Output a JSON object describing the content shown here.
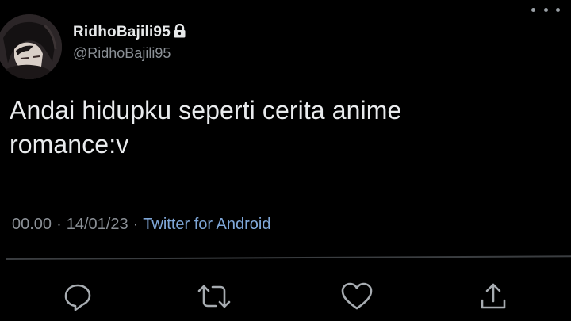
{
  "tweet": {
    "display_name": "RidhoBajili95",
    "handle": "@RidhoBajili95",
    "text": "Andai hidupku seperti cerita anime romance:v",
    "time": "00.00",
    "date": "14/01/23",
    "separator": "·",
    "source": "Twitter for Android",
    "protected_icon": "lock-icon"
  },
  "actions": {
    "icons": [
      "reply-icon",
      "retweet-icon",
      "like-icon",
      "share-icon"
    ]
  },
  "colors": {
    "background": "#000000",
    "text": "#e7e9ea",
    "secondary": "#8b9096",
    "link": "#7fa7d8"
  }
}
